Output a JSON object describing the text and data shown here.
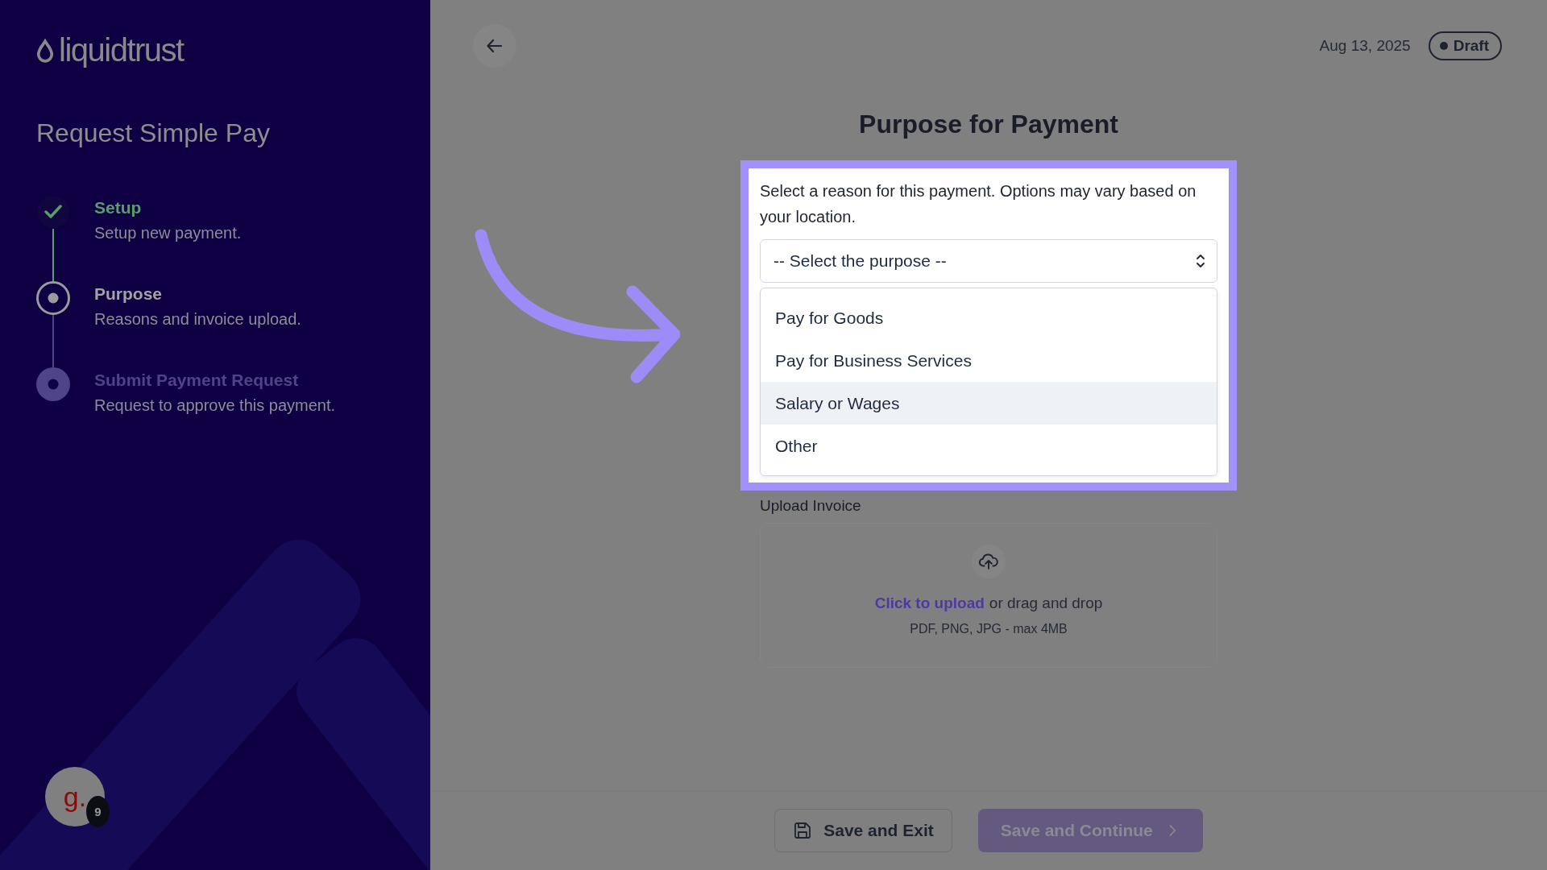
{
  "sidebar": {
    "logo": "liquidtrust",
    "title": "Request Simple Pay",
    "steps": [
      {
        "title": "Setup",
        "description": "Setup new payment.",
        "kind": "done"
      },
      {
        "title": "Purpose",
        "description": "Reasons and invoice upload.",
        "kind": "current"
      },
      {
        "title": "Submit Payment Request",
        "description": "Request to approve this payment.",
        "kind": "upcoming"
      }
    ],
    "avatar": {
      "initial": "g.",
      "badge": "9"
    }
  },
  "header": {
    "date": "Aug 13, 2025",
    "status": "Draft"
  },
  "form": {
    "heading": "Purpose for Payment",
    "description": "Select a reason for this payment. Options may vary based on your location.",
    "select": {
      "placeholder": "-- Select the purpose --",
      "options": [
        {
          "label": "Pay for Goods",
          "highlighted": false
        },
        {
          "label": "Pay for Business Services",
          "highlighted": false
        },
        {
          "label": "Salary or Wages",
          "highlighted": true
        },
        {
          "label": "Other",
          "highlighted": false
        }
      ]
    },
    "upload": {
      "label": "Upload Invoice",
      "link": "Click to upload",
      "text": "or drag and drop",
      "hint": "PDF, PNG, JPG - max 4MB"
    }
  },
  "footer": {
    "buttons": [
      {
        "label": "Save and Exit",
        "kind": "secondary",
        "disabled": false
      },
      {
        "label": "Save and Continue",
        "kind": "primary",
        "disabled": true
      }
    ]
  }
}
